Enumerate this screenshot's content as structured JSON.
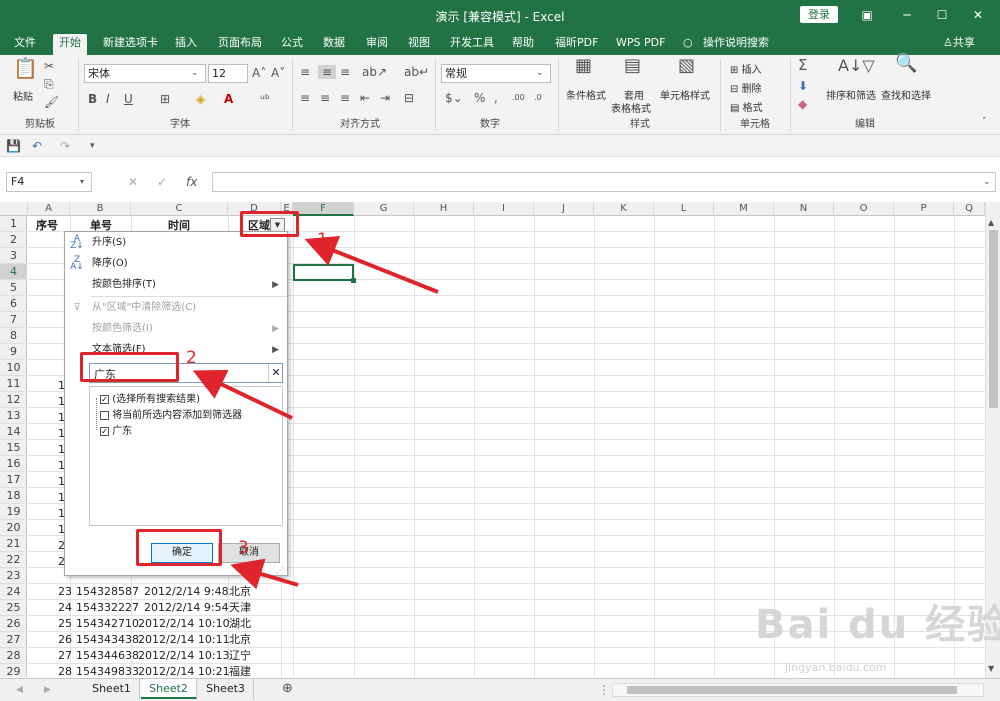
{
  "window": {
    "title": "演示 [兼容模式]  -  Excel",
    "login": "登录",
    "share": "共享"
  },
  "tabs": [
    "文件",
    "开始",
    "新建选项卡",
    "插入",
    "页面布局",
    "公式",
    "数据",
    "审阅",
    "视图",
    "开发工具",
    "帮助",
    "福昕PDF",
    "WPS PDF",
    "操作说明搜索"
  ],
  "ribbon": {
    "font_name": "宋体",
    "font_size": "12",
    "number_format": "常规",
    "paste": "粘贴",
    "cond_format": "条件格式",
    "table_format_1": "套用",
    "table_format_2": "表格格式",
    "cell_style": "单元格样式",
    "insert": "插入",
    "delete": "删除",
    "format": "格式",
    "sort_filter": "排序和筛选",
    "find_select": "查找和选择",
    "groups": [
      "剪贴板",
      "字体",
      "对齐方式",
      "数字",
      "样式",
      "单元格",
      "编辑"
    ]
  },
  "formula": {
    "name_box": "F4",
    "fx": "fx"
  },
  "columns": [
    "A",
    "B",
    "C",
    "D",
    "E",
    "F",
    "G",
    "H",
    "I",
    "J",
    "K",
    "L",
    "M",
    "N",
    "O",
    "P",
    "Q"
  ],
  "rows": [
    "1",
    "2",
    "3",
    "4",
    "5",
    "6",
    "7",
    "8",
    "9",
    "10",
    "11",
    "12",
    "13",
    "14",
    "15",
    "16",
    "17",
    "18",
    "19",
    "20",
    "21",
    "22",
    "23",
    "24",
    "25",
    "26",
    "27",
    "28",
    "29"
  ],
  "headers": {
    "a": "序号",
    "b": "单号",
    "c": "时间",
    "d": "区域"
  },
  "partial_col_a": [
    "1",
    "1",
    "1",
    "1",
    "1",
    "1",
    "1",
    "1",
    "1",
    "1",
    "2",
    "2"
  ],
  "table_rows": [
    {
      "a": "23",
      "b": "154328587",
      "c": "2012/2/14  9:48",
      "d": "北京"
    },
    {
      "a": "24",
      "b": "154332227",
      "c": "2012/2/14  9:54",
      "d": "天津"
    },
    {
      "a": "25",
      "b": "154342710",
      "c": "2012/2/14 10:10",
      "d": "湖北"
    },
    {
      "a": "26",
      "b": "154343438",
      "c": "2012/2/14 10:11",
      "d": "北京"
    },
    {
      "a": "27",
      "b": "154344638",
      "c": "2012/2/14 10:13",
      "d": "辽宁"
    },
    {
      "a": "28",
      "b": "154349833",
      "c": "2012/2/14 10:21",
      "d": "福建"
    }
  ],
  "filter_menu": {
    "sort_asc": "升序(S)",
    "sort_desc": "降序(O)",
    "sort_color": "按颜色排序(T)",
    "clear_filter": "从\"区域\"中清除筛选(C)",
    "filter_color": "按颜色筛选(I)",
    "text_filter": "文本筛选(F)",
    "search_value": "广东",
    "options": [
      "(选择所有搜索结果)",
      "将当前所选内容添加到筛选器",
      "广东"
    ],
    "ok": "确定",
    "cancel": "取消"
  },
  "annotations": [
    "1",
    "2",
    "3"
  ],
  "sheets": [
    "Sheet1",
    "Sheet2",
    "Sheet3"
  ],
  "watermark": {
    "brand": "Bai du 经验",
    "url": "jingyan.baidu.com"
  },
  "colors": {
    "accent": "#217346",
    "annotation": "#e0242c"
  }
}
